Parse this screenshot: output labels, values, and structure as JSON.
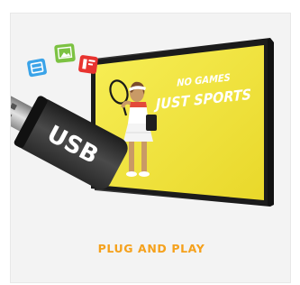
{
  "card": {
    "caption": "PLUG AND PLAY"
  },
  "screen": {
    "headline_line1": "NO GAMES",
    "headline_line2": "JUST SPORTS",
    "background_color": "#f2e63a"
  },
  "usb_drive": {
    "label": "USB"
  },
  "app_icons": [
    {
      "name": "document-icon",
      "color": "#3aa3e8"
    },
    {
      "name": "image-icon",
      "color": "#7cc242"
    },
    {
      "name": "presentation-icon",
      "color": "#e8332f"
    }
  ],
  "accent_color": "#f5a11c"
}
